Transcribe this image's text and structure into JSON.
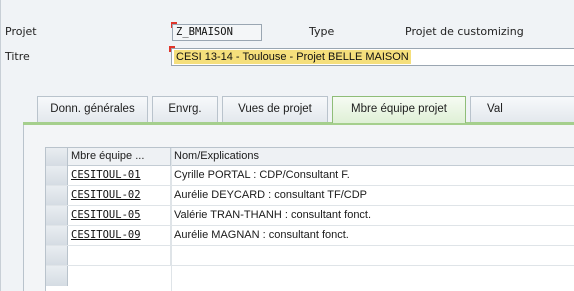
{
  "header": {
    "project_label": "Projet",
    "project_value": "Z_BMAISON",
    "type_label": "Type",
    "type_value": "Projet de customizing",
    "title_label": "Titre",
    "title_value": "CESI 13-14 - Toulouse - Projet BELLE MAISON"
  },
  "tabs": [
    {
      "label": "Donn. générales",
      "active": false
    },
    {
      "label": "Envrg.",
      "active": false
    },
    {
      "label": "Vues de projet",
      "active": false
    },
    {
      "label": "Mbre équipe projet",
      "active": true
    },
    {
      "label": "Val",
      "active": false
    }
  ],
  "table": {
    "columns": [
      "Mbre équipe ...",
      "Nom/Explications"
    ],
    "rows": [
      [
        "CESITOUL-01",
        "Cyrille PORTAL : CDP/Consultant F."
      ],
      [
        "CESITOUL-02",
        "Aurélie DEYCARD : consultant TF/CDP"
      ],
      [
        "CESITOUL-05",
        "Valérie TRAN-THANH : consultant fonct."
      ],
      [
        "CESITOUL-09",
        "Aurélie MAGNAN : consultant fonct."
      ],
      [
        "",
        ""
      ]
    ]
  },
  "colors": {
    "active_tab_border": "#8fbd78",
    "title_highlight": "#f5df7c",
    "required_marker": "#e0352b"
  }
}
